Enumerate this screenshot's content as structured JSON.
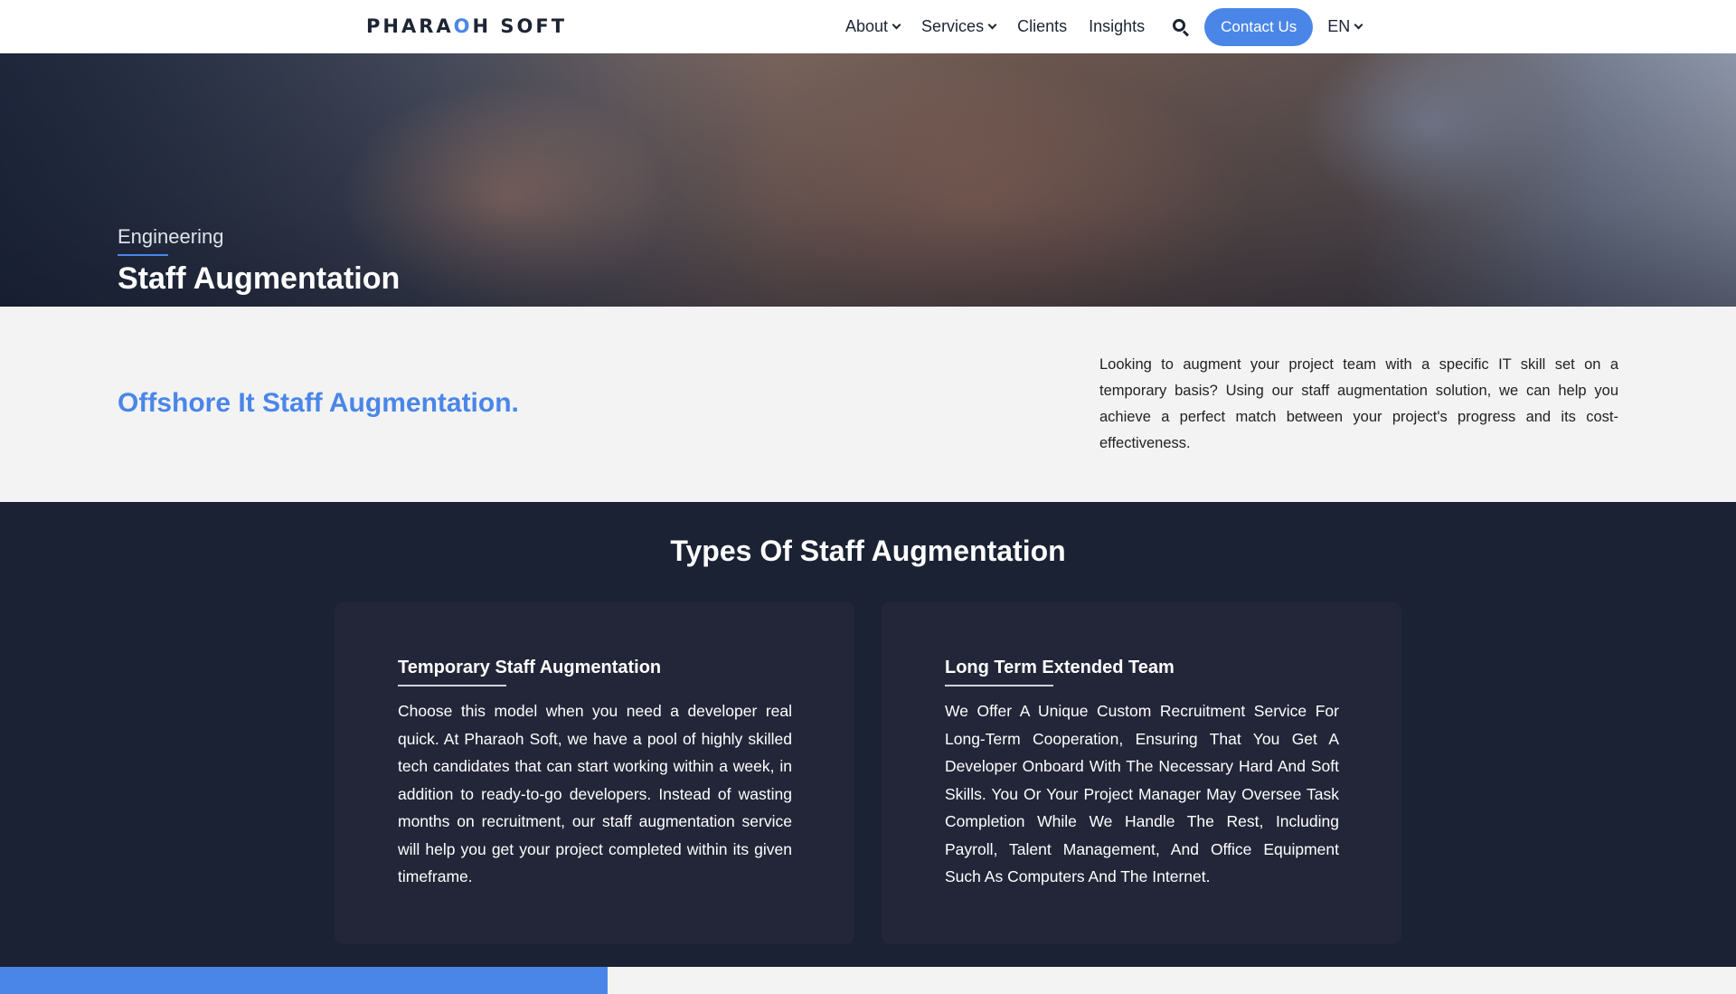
{
  "nav": {
    "logo_part1": "PHARA",
    "logo_accent": "O",
    "logo_part2": "H SOFT",
    "items": [
      {
        "label": "About",
        "has_dropdown": true
      },
      {
        "label": "Services",
        "has_dropdown": true
      },
      {
        "label": "Clients",
        "has_dropdown": false
      },
      {
        "label": "Insights",
        "has_dropdown": false
      }
    ],
    "search_icon": "search-icon",
    "contact_label": "Contact Us",
    "lang_label": "EN"
  },
  "hero": {
    "subtitle": "Engineering",
    "title": "Staff Augmentation"
  },
  "intro": {
    "heading": "Offshore It Staff Augmentation.",
    "text": "Looking to augment your project team with a specific IT skill set on a temporary basis? Using our staff augmentation solution, we can help you achieve a perfect match between your project's progress and its cost-effectiveness."
  },
  "types": {
    "title": "Types Of Staff Augmentation",
    "cards": [
      {
        "title": "Temporary Staff Augmentation",
        "text": "Choose this model when you need a developer real quick. At Pharaoh Soft, we have a pool of highly skilled tech candidates that can start working within a week, in addition to ready-to-go developers. Instead of wasting months on recruitment, our staff augmentation service will help you get your project completed within its given timeframe."
      },
      {
        "title": "Long Term Extended Team",
        "text": "We Offer A Unique Custom Recruitment Service For Long-Term Cooperation, Ensuring That You Get A Developer Onboard With The Necessary Hard And Soft Skills. You Or Your Project Manager May Oversee Task Completion While We Handle The Rest, Including Payroll, Talent Management, And Office Equipment Such As Computers And The Internet."
      }
    ]
  },
  "colors": {
    "accent": "#4a86e8",
    "dark_section": "#1b2233",
    "card_bg": "#232638",
    "light_bg": "#f3f3f3"
  }
}
